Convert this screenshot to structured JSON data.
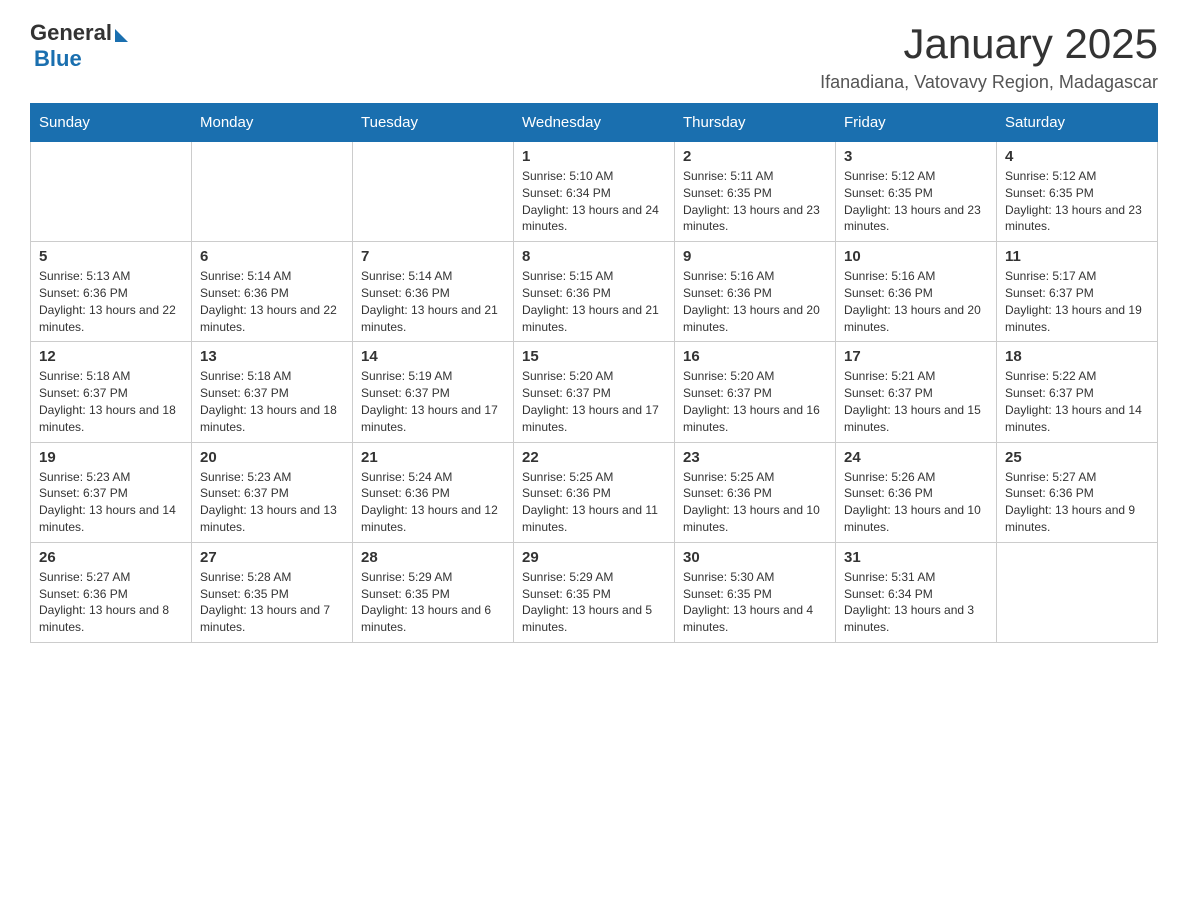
{
  "header": {
    "logo": {
      "general": "General",
      "blue": "Blue"
    },
    "title": "January 2025",
    "subtitle": "Ifanadiana, Vatovavy Region, Madagascar"
  },
  "calendar": {
    "days_of_week": [
      "Sunday",
      "Monday",
      "Tuesday",
      "Wednesday",
      "Thursday",
      "Friday",
      "Saturday"
    ],
    "weeks": [
      [
        {
          "day": "",
          "info": ""
        },
        {
          "day": "",
          "info": ""
        },
        {
          "day": "",
          "info": ""
        },
        {
          "day": "1",
          "info": "Sunrise: 5:10 AM\nSunset: 6:34 PM\nDaylight: 13 hours and 24 minutes."
        },
        {
          "day": "2",
          "info": "Sunrise: 5:11 AM\nSunset: 6:35 PM\nDaylight: 13 hours and 23 minutes."
        },
        {
          "day": "3",
          "info": "Sunrise: 5:12 AM\nSunset: 6:35 PM\nDaylight: 13 hours and 23 minutes."
        },
        {
          "day": "4",
          "info": "Sunrise: 5:12 AM\nSunset: 6:35 PM\nDaylight: 13 hours and 23 minutes."
        }
      ],
      [
        {
          "day": "5",
          "info": "Sunrise: 5:13 AM\nSunset: 6:36 PM\nDaylight: 13 hours and 22 minutes."
        },
        {
          "day": "6",
          "info": "Sunrise: 5:14 AM\nSunset: 6:36 PM\nDaylight: 13 hours and 22 minutes."
        },
        {
          "day": "7",
          "info": "Sunrise: 5:14 AM\nSunset: 6:36 PM\nDaylight: 13 hours and 21 minutes."
        },
        {
          "day": "8",
          "info": "Sunrise: 5:15 AM\nSunset: 6:36 PM\nDaylight: 13 hours and 21 minutes."
        },
        {
          "day": "9",
          "info": "Sunrise: 5:16 AM\nSunset: 6:36 PM\nDaylight: 13 hours and 20 minutes."
        },
        {
          "day": "10",
          "info": "Sunrise: 5:16 AM\nSunset: 6:36 PM\nDaylight: 13 hours and 20 minutes."
        },
        {
          "day": "11",
          "info": "Sunrise: 5:17 AM\nSunset: 6:37 PM\nDaylight: 13 hours and 19 minutes."
        }
      ],
      [
        {
          "day": "12",
          "info": "Sunrise: 5:18 AM\nSunset: 6:37 PM\nDaylight: 13 hours and 18 minutes."
        },
        {
          "day": "13",
          "info": "Sunrise: 5:18 AM\nSunset: 6:37 PM\nDaylight: 13 hours and 18 minutes."
        },
        {
          "day": "14",
          "info": "Sunrise: 5:19 AM\nSunset: 6:37 PM\nDaylight: 13 hours and 17 minutes."
        },
        {
          "day": "15",
          "info": "Sunrise: 5:20 AM\nSunset: 6:37 PM\nDaylight: 13 hours and 17 minutes."
        },
        {
          "day": "16",
          "info": "Sunrise: 5:20 AM\nSunset: 6:37 PM\nDaylight: 13 hours and 16 minutes."
        },
        {
          "day": "17",
          "info": "Sunrise: 5:21 AM\nSunset: 6:37 PM\nDaylight: 13 hours and 15 minutes."
        },
        {
          "day": "18",
          "info": "Sunrise: 5:22 AM\nSunset: 6:37 PM\nDaylight: 13 hours and 14 minutes."
        }
      ],
      [
        {
          "day": "19",
          "info": "Sunrise: 5:23 AM\nSunset: 6:37 PM\nDaylight: 13 hours and 14 minutes."
        },
        {
          "day": "20",
          "info": "Sunrise: 5:23 AM\nSunset: 6:37 PM\nDaylight: 13 hours and 13 minutes."
        },
        {
          "day": "21",
          "info": "Sunrise: 5:24 AM\nSunset: 6:36 PM\nDaylight: 13 hours and 12 minutes."
        },
        {
          "day": "22",
          "info": "Sunrise: 5:25 AM\nSunset: 6:36 PM\nDaylight: 13 hours and 11 minutes."
        },
        {
          "day": "23",
          "info": "Sunrise: 5:25 AM\nSunset: 6:36 PM\nDaylight: 13 hours and 10 minutes."
        },
        {
          "day": "24",
          "info": "Sunrise: 5:26 AM\nSunset: 6:36 PM\nDaylight: 13 hours and 10 minutes."
        },
        {
          "day": "25",
          "info": "Sunrise: 5:27 AM\nSunset: 6:36 PM\nDaylight: 13 hours and 9 minutes."
        }
      ],
      [
        {
          "day": "26",
          "info": "Sunrise: 5:27 AM\nSunset: 6:36 PM\nDaylight: 13 hours and 8 minutes."
        },
        {
          "day": "27",
          "info": "Sunrise: 5:28 AM\nSunset: 6:35 PM\nDaylight: 13 hours and 7 minutes."
        },
        {
          "day": "28",
          "info": "Sunrise: 5:29 AM\nSunset: 6:35 PM\nDaylight: 13 hours and 6 minutes."
        },
        {
          "day": "29",
          "info": "Sunrise: 5:29 AM\nSunset: 6:35 PM\nDaylight: 13 hours and 5 minutes."
        },
        {
          "day": "30",
          "info": "Sunrise: 5:30 AM\nSunset: 6:35 PM\nDaylight: 13 hours and 4 minutes."
        },
        {
          "day": "31",
          "info": "Sunrise: 5:31 AM\nSunset: 6:34 PM\nDaylight: 13 hours and 3 minutes."
        },
        {
          "day": "",
          "info": ""
        }
      ]
    ]
  }
}
